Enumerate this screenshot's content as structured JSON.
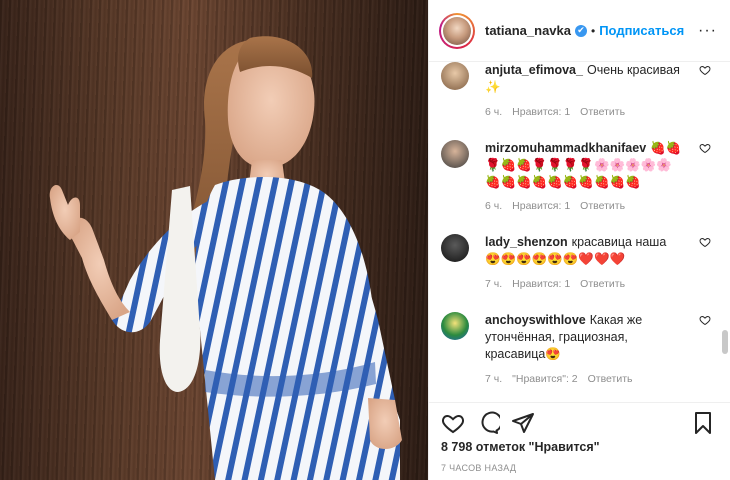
{
  "header": {
    "username": "tatiana_navka",
    "verified_mark": "✔",
    "separator": "•",
    "subscribe_label": "Подписаться",
    "more_label": "···"
  },
  "comments": [
    {
      "user": "anjuta_efimova_",
      "text": "Очень красивая ✨",
      "age": "6 ч.",
      "likes": "Нравится: 1",
      "reply": "Ответить"
    },
    {
      "user": "mirzomuhammadkhanifaev",
      "text": "🍓🍓🌹🍓🍓🌹🌹🌹🌹🌸🌸🌸🌸🌸🍓🍓🍓🍓🍓🍓🍓🍓🍓🍓",
      "age": "6 ч.",
      "likes": "Нравится: 1",
      "reply": "Ответить"
    },
    {
      "user": "lady_shenzon",
      "text": "красавица наша 😍😍😍😍😍😍❤️❤️❤️",
      "age": "7 ч.",
      "likes": "Нравится: 1",
      "reply": "Ответить"
    },
    {
      "user": "anchoyswithlove",
      "text": "Какая же утончённая, грациозная, красавица😍",
      "age": "7 ч.",
      "likes": "\"Нравится\": 2",
      "reply": "Ответить"
    }
  ],
  "footer": {
    "likes_count": "8 798 отметок \"Нравится\"",
    "posted_ago": "7 ЧАСОВ НАЗАД"
  },
  "icons": {
    "like": "heart-icon",
    "comment": "comment-icon",
    "share": "share-icon",
    "save": "bookmark-icon"
  },
  "colors": {
    "accent": "#0095f6",
    "text": "#262626",
    "meta": "#8e8e8e"
  }
}
